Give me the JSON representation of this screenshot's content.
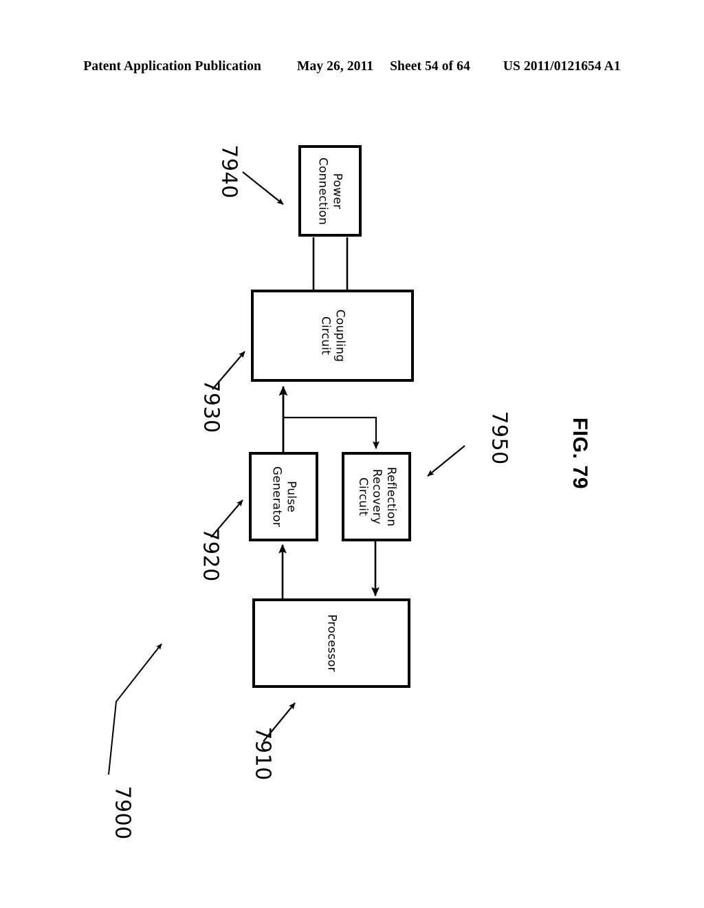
{
  "header": {
    "publication": "Patent Application Publication",
    "date": "May 26, 2011",
    "sheet": "Sheet 54 of 64",
    "patent_number": "US 2011/0121654 A1"
  },
  "figure": {
    "caption": "FIG. 79",
    "system_numeral": "7900"
  },
  "nodes": [
    {
      "id": "power",
      "label": "Power\nConnection",
      "numeral": "7940"
    },
    {
      "id": "coupling",
      "label": "Coupling\nCircuit",
      "numeral": "7930"
    },
    {
      "id": "pulse",
      "label": "Pulse\nGenerator",
      "numeral": "7920"
    },
    {
      "id": "reflection",
      "label": "Reflection\nRecovery\nCircuit",
      "numeral": "7950"
    },
    {
      "id": "processor",
      "label": "Processor",
      "numeral": "7910"
    }
  ],
  "connections": [
    {
      "from": "power",
      "to": "coupling",
      "style": "double-line",
      "arrow": false
    },
    {
      "from": "pulse",
      "to": "coupling",
      "style": "line",
      "arrow": true
    },
    {
      "from": "pulse",
      "to": "reflection",
      "style": "branch",
      "arrow": true
    },
    {
      "from": "processor",
      "to": "pulse",
      "style": "line",
      "arrow": true
    },
    {
      "from": "reflection",
      "to": "processor",
      "style": "line",
      "arrow": true
    }
  ],
  "colors": {
    "ink": "#000000",
    "paper": "#ffffff"
  }
}
